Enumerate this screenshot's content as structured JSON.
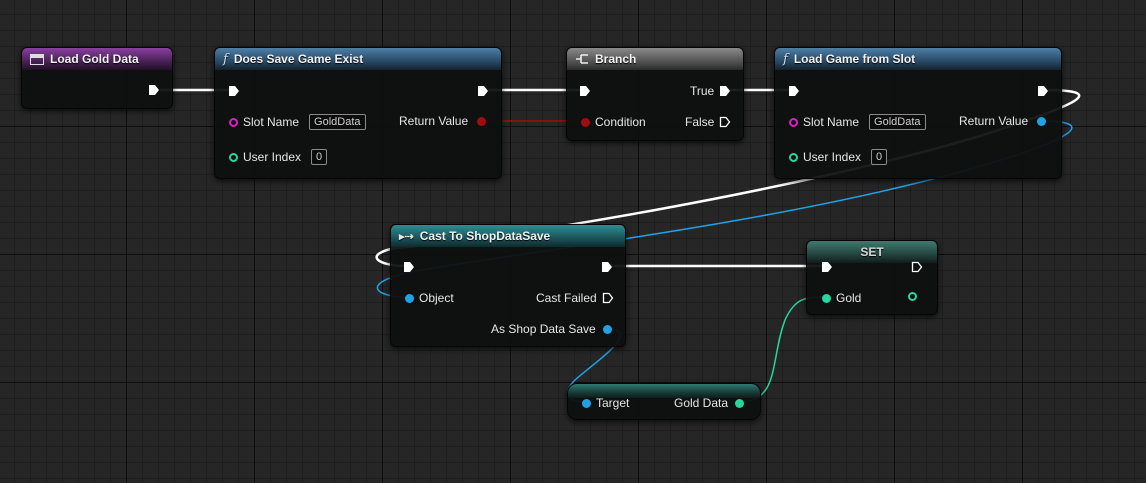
{
  "nodes": {
    "load_gold_data": {
      "title": "Load Gold Data"
    },
    "does_save_game_exist": {
      "title": "Does Save Game Exist",
      "slot_name_label": "Slot Name",
      "slot_name_value": "GoldData",
      "user_index_label": "User Index",
      "user_index_value": "0",
      "return_value_label": "Return Value"
    },
    "branch": {
      "title": "Branch",
      "true_label": "True",
      "condition_label": "Condition",
      "false_label": "False"
    },
    "load_game_from_slot": {
      "title": "Load Game from Slot",
      "slot_name_label": "Slot Name",
      "slot_name_value": "GoldData",
      "user_index_label": "User Index",
      "user_index_value": "0",
      "return_value_label": "Return Value"
    },
    "cast_to_shopdatasave": {
      "title": "Cast To ShopDataSave",
      "object_label": "Object",
      "cast_failed_label": "Cast Failed",
      "as_shop_data_save_label": "As Shop Data Save"
    },
    "set_node": {
      "title": "SET",
      "gold_label": "Gold"
    },
    "gold_data_getter": {
      "target_label": "Target",
      "gold_data_label": "Gold Data"
    }
  },
  "colors": {
    "exec": "#ffffff",
    "boolean": "#a00d0d",
    "object": "#1fa3e8",
    "string": "#de1ec4",
    "integer": "#27d6a0",
    "event_header": "#8a3fa0",
    "function_header": "#4d7fa6",
    "cast_header": "#2f8d92"
  }
}
